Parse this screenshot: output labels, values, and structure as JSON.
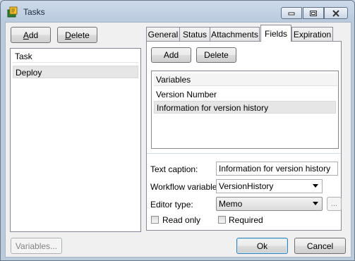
{
  "window": {
    "title": "Tasks"
  },
  "toolbar": {
    "add_label": "Add",
    "add_mnemonic": "A",
    "add_rest": "dd",
    "delete_label": "Delete",
    "delete_mnemonic": "D",
    "delete_rest": "elete"
  },
  "tasks": {
    "header": "Task",
    "items": [
      "Deploy"
    ],
    "selected": "Deploy"
  },
  "tabs": [
    {
      "label": "General",
      "active": false
    },
    {
      "label": "Status",
      "active": false
    },
    {
      "label": "Attachments",
      "active": false
    },
    {
      "label": "Fields",
      "active": true
    },
    {
      "label": "Expiration",
      "active": false
    }
  ],
  "fields_tab": {
    "add_label": "Add",
    "delete_label": "Delete",
    "variables_header": "Variables",
    "variables": [
      "Version Number",
      "Information for version history"
    ],
    "selected_variable": "Information for version history"
  },
  "form": {
    "text_caption_label": "Text caption:",
    "text_caption_value": "Information for version history",
    "workflow_variable_label": "Workflow variable:",
    "workflow_variable_value": "VersionHistory",
    "editor_type_label": "Editor type:",
    "editor_type_value": "Memo",
    "ellipsis_label": "...",
    "read_only_label": "Read only",
    "read_only_checked": false,
    "required_label": "Required",
    "required_checked": false
  },
  "footer": {
    "variables_label": "Variables...",
    "ok_label": "Ok",
    "cancel_label": "Cancel"
  }
}
